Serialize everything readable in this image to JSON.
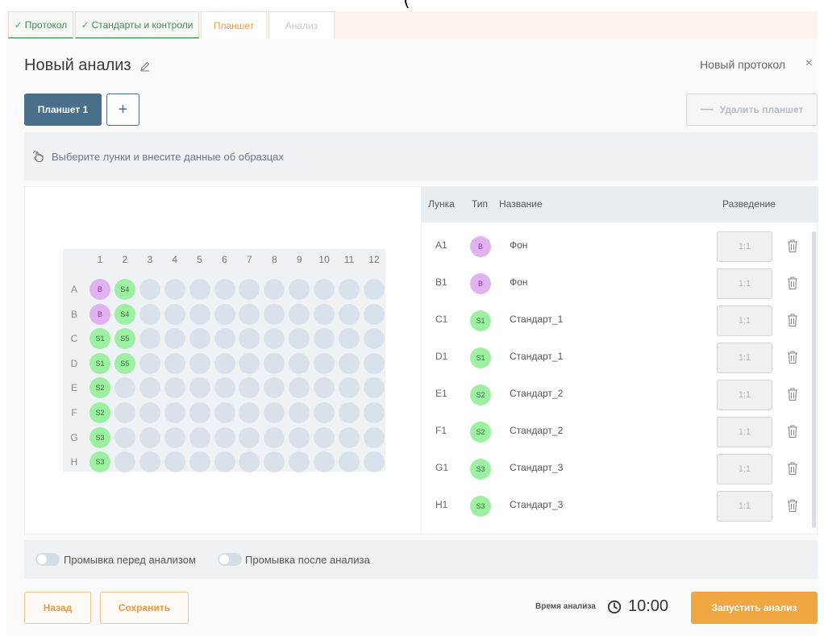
{
  "tabs": [
    {
      "label": "Протокол",
      "state": "done"
    },
    {
      "label": "Стандарты и контроли",
      "state": "done"
    },
    {
      "label": "Планшет",
      "state": "active"
    },
    {
      "label": "Анализ",
      "state": "disabled"
    }
  ],
  "header": {
    "title": "Новый анализ",
    "protocol_link": "Новый протокол",
    "close_label": "×"
  },
  "plate_tabs": {
    "current": "Планшет 1",
    "add_label": "+",
    "delete_label": "Удалить планшет"
  },
  "hint": "Выберите лунки и внесите данные об образцах",
  "plate": {
    "columns": [
      "1",
      "2",
      "3",
      "4",
      "5",
      "6",
      "7",
      "8",
      "9",
      "10",
      "11",
      "12"
    ],
    "rows": [
      "A",
      "B",
      "C",
      "D",
      "E",
      "F",
      "G",
      "H"
    ],
    "filled": {
      "A": [
        {
          "label": "B",
          "type": "b"
        },
        {
          "label": "S4",
          "type": "s"
        }
      ],
      "B": [
        {
          "label": "B",
          "type": "b"
        },
        {
          "label": "S4",
          "type": "s"
        }
      ],
      "C": [
        {
          "label": "S1",
          "type": "s"
        },
        {
          "label": "S5",
          "type": "s"
        }
      ],
      "D": [
        {
          "label": "S1",
          "type": "s"
        },
        {
          "label": "S5",
          "type": "s"
        }
      ],
      "E": [
        {
          "label": "S2",
          "type": "s"
        }
      ],
      "F": [
        {
          "label": "S2",
          "type": "s"
        }
      ],
      "G": [
        {
          "label": "S3",
          "type": "s"
        }
      ],
      "H": [
        {
          "label": "S3",
          "type": "s"
        }
      ]
    }
  },
  "sample_table": {
    "headers": {
      "well": "Лунка",
      "type": "Тип",
      "name": "Название",
      "dilution": "Разведение"
    },
    "rows": [
      {
        "well": "A1",
        "type": "B",
        "kind": "b",
        "name": "Фон",
        "dilution": "1:1"
      },
      {
        "well": "B1",
        "type": "B",
        "kind": "b",
        "name": "Фон",
        "dilution": "1:1"
      },
      {
        "well": "C1",
        "type": "S1",
        "kind": "s",
        "name": "Стандарт_1",
        "dilution": "1:1"
      },
      {
        "well": "D1",
        "type": "S1",
        "kind": "s",
        "name": "Стандарт_1",
        "dilution": "1:1"
      },
      {
        "well": "E1",
        "type": "S2",
        "kind": "s",
        "name": "Стандарт_2",
        "dilution": "1:1"
      },
      {
        "well": "F1",
        "type": "S2",
        "kind": "s",
        "name": "Стандарт_2",
        "dilution": "1:1"
      },
      {
        "well": "G1",
        "type": "S3",
        "kind": "s",
        "name": "Стандарт_3",
        "dilution": "1:1"
      },
      {
        "well": "H1",
        "type": "S3",
        "kind": "s",
        "name": "Стандарт_3",
        "dilution": "1:1"
      }
    ]
  },
  "options": {
    "wash_before": {
      "label": "Промывка перед анализом",
      "on": false
    },
    "wash_after": {
      "label": "Промывка после анализа",
      "on": false
    }
  },
  "footer": {
    "back_label": "Назад",
    "save_label": "Сохранить",
    "time_label": "Время анализа",
    "time_value": "10:00",
    "start_label": "Запустить анализ"
  },
  "colors": {
    "accent": "#f0a742",
    "primary": "#4a6f8a",
    "blank_well": "#e0b3f0",
    "standard_well": "#9df0a1",
    "empty_well": "#d9e2ea",
    "done_tab": "#3d8d52"
  },
  "icons": {
    "edit": "pencil-icon",
    "hint": "pointer-hand-icon",
    "trash": "trash-icon",
    "clock": "clock-icon",
    "check": "check-icon"
  }
}
